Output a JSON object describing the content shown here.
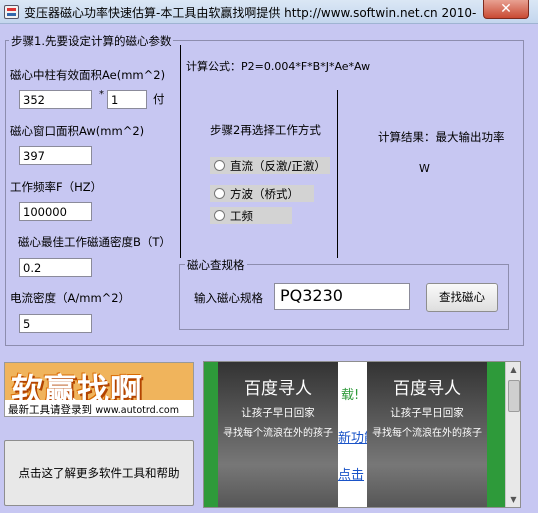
{
  "window": {
    "title": "变压器磁心功率快速估算-本工具由软赢找啊提供 http://www.softwin.net.cn 2010-",
    "close_glyph": "✕"
  },
  "step1": {
    "heading": "步骤1.先要设定计算的磁心参数",
    "ae_label": "磁心中柱有效面积Ae(mm^2)",
    "ae_value": "352",
    "multiply_symbol": "*",
    "count_value": "1",
    "count_unit": "付",
    "aw_label": "磁心窗口面积Aw(mm^2)",
    "aw_value": "397",
    "freq_label": "工作频率F（HZ）",
    "freq_value": "100000",
    "flux_label": "磁心最佳工作磁通密度B（T）",
    "flux_value": "0.2",
    "current_label": "电流密度（A/mm^2）",
    "current_value": "5"
  },
  "formula": {
    "text": "计算公式：P2=0.004*F*B*J*Ae*Aw"
  },
  "step2": {
    "heading": "步骤2再选择工作方式",
    "options": [
      "直流（反激/正激）",
      "方波（桥式）",
      "工频"
    ]
  },
  "result": {
    "heading": "计算结果：最大输出功率",
    "unit": "W"
  },
  "lookup": {
    "heading": "磁心查规格",
    "input_label": "输入磁心规格",
    "input_value": "PQ3230",
    "button_label": "查找磁心"
  },
  "promo": {
    "logo_text": "软赢找啊",
    "tagline": "最新工具请登录到",
    "url": "www.autotrd.com",
    "help_button_label": "点击这了解更多软件工具和帮助"
  },
  "ad": {
    "card_title": "百度寻人",
    "card_line1": "让孩子早日回家",
    "card_line2": "寻找每个流浪在外的孩子",
    "fragment_1": "载!",
    "fragment_2": "新功能",
    "fragment_3": "点击"
  },
  "colors": {
    "background": "#c7c7f2",
    "logo_orange": "#f0b45c",
    "ad_green": "#2e9a3a",
    "link_blue": "#1a54c8"
  }
}
